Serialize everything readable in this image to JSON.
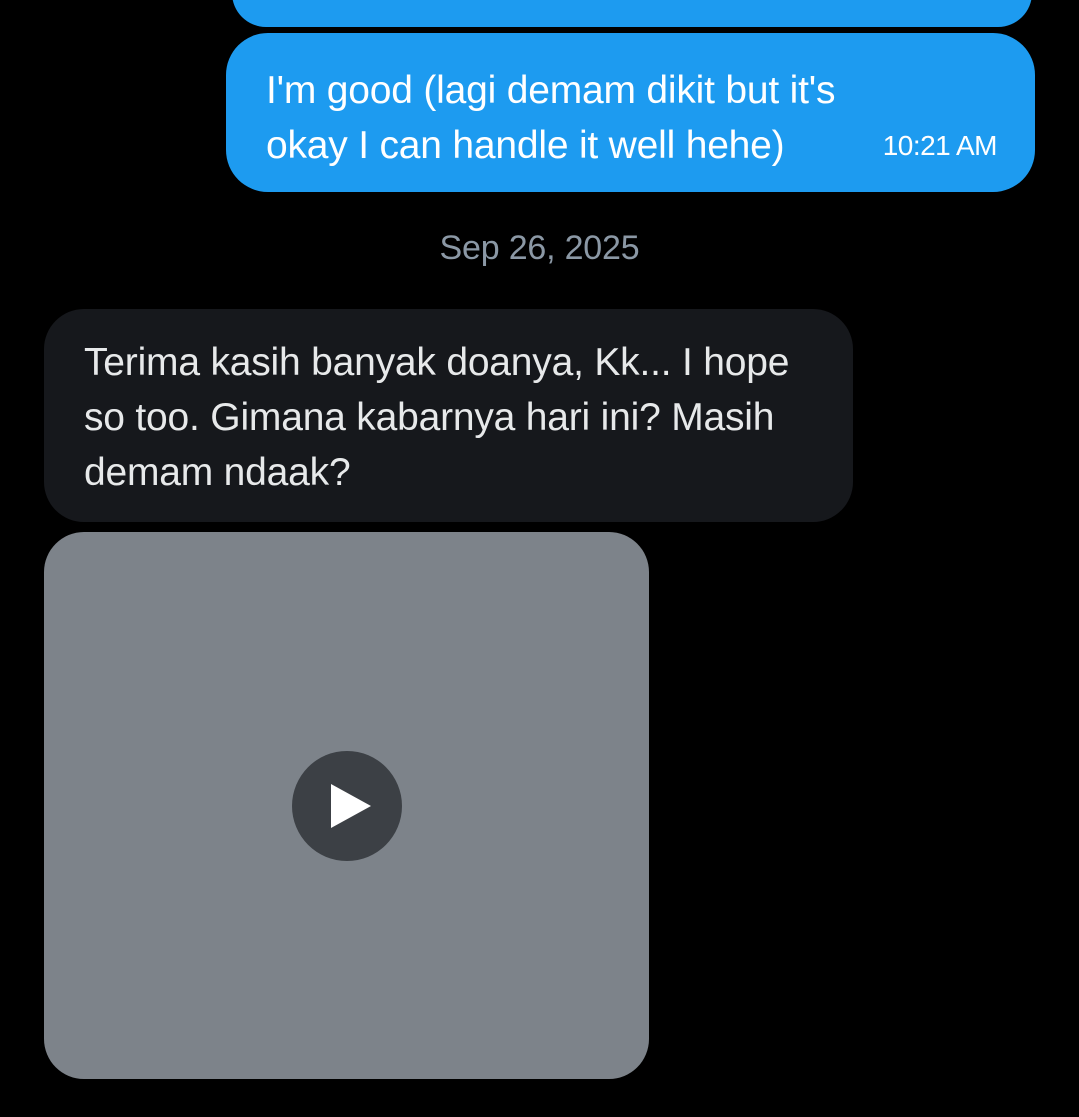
{
  "conversation": {
    "messages": [
      {
        "direction": "outgoing",
        "text": "",
        "time": ""
      },
      {
        "direction": "outgoing",
        "text": "I'm good (lagi demam dikit but it's okay I can handle it well hehe)",
        "time": "10:21 AM"
      }
    ],
    "date_separator": "Sep 26, 2025",
    "incoming": {
      "text": "Terima kasih banyak doanya, Kk... I hope so too. Gimana kabarnya hari ini? Masih demam ndaak?"
    },
    "media": {
      "kind": "video",
      "icon": "play-icon"
    }
  },
  "colors": {
    "outgoing_bubble": "#1d9bf0",
    "incoming_bubble": "#16181c",
    "background": "#000000",
    "date_text": "#8b98a5",
    "media_placeholder": "#7d838a",
    "play_button": "#3c4045"
  }
}
